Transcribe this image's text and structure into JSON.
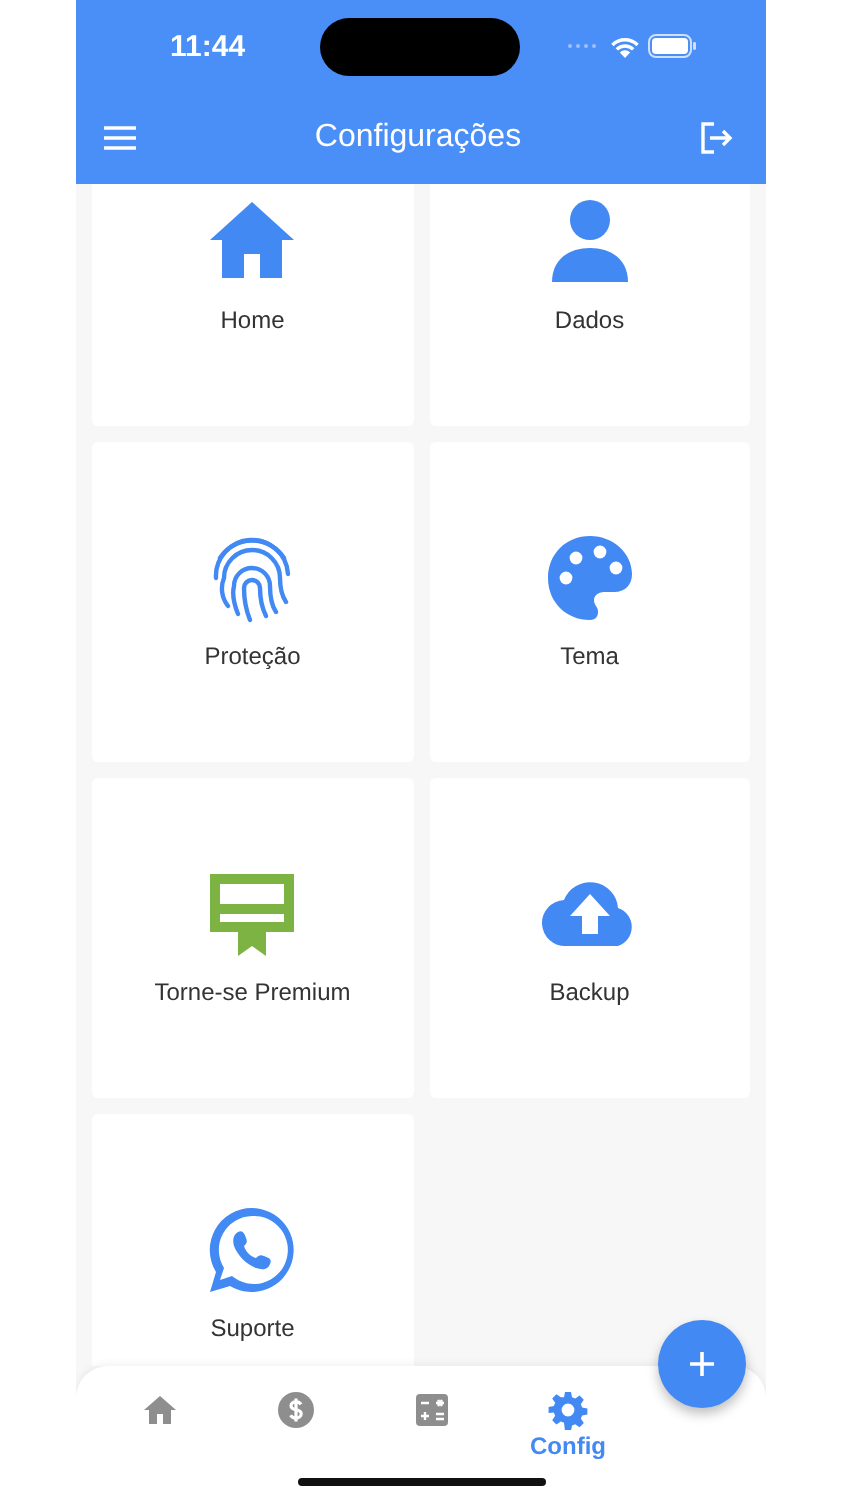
{
  "status_bar": {
    "time": "11:44"
  },
  "header": {
    "title": "Configurações"
  },
  "tiles": [
    {
      "label": "Home",
      "color": "#4289f4"
    },
    {
      "label": "Dados",
      "color": "#4289f4"
    },
    {
      "label": "Proteção",
      "color": "#4289f4"
    },
    {
      "label": "Tema",
      "color": "#4289f4"
    },
    {
      "label": "Torne-se Premium",
      "color": "#7cb342"
    },
    {
      "label": "Backup",
      "color": "#4289f4"
    },
    {
      "label": "Suporte",
      "color": "#4289f4"
    }
  ],
  "bottom_nav": [
    {
      "selected": false
    },
    {
      "selected": false
    },
    {
      "selected": false
    },
    {
      "label": "Config",
      "selected": true
    }
  ]
}
